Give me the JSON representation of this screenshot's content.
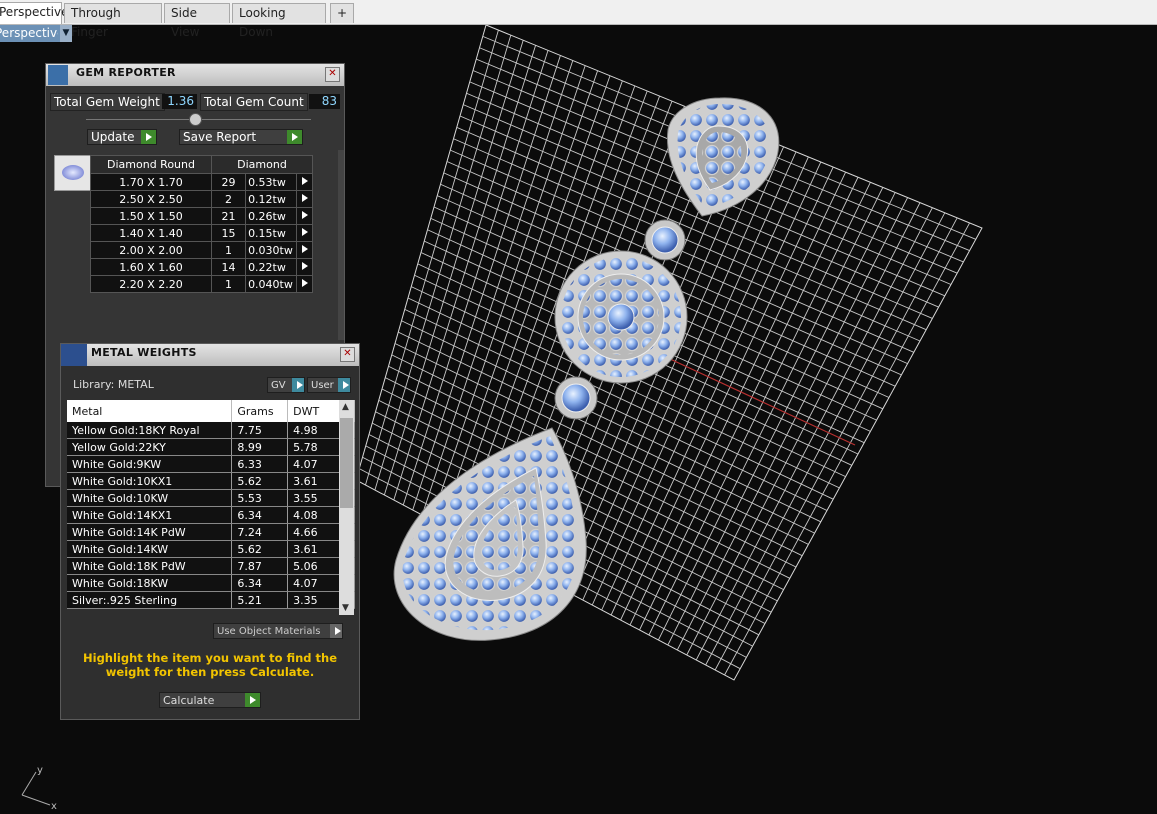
{
  "tabs": [
    "Perspective",
    "Through Finger",
    "Side View",
    "Looking Down"
  ],
  "add_tab": "+",
  "viewport_label": "Perspective",
  "gem_reporter": {
    "title": "GEM REPORTER",
    "total_weight_label": "Total Gem Weight",
    "total_weight": "1.36",
    "total_count_label": "Total Gem Count",
    "total_count": "83",
    "update_label": "Update",
    "save_label": "Save Report",
    "col_shape": "Diamond Round",
    "col_material": "Diamond",
    "rows": [
      {
        "size": "1.70 X 1.70",
        "count": "29",
        "tw": "0.53tw"
      },
      {
        "size": "2.50 X 2.50",
        "count": "2",
        "tw": "0.12tw"
      },
      {
        "size": "1.50 X 1.50",
        "count": "21",
        "tw": "0.26tw"
      },
      {
        "size": "1.40 X 1.40",
        "count": "15",
        "tw": "0.15tw"
      },
      {
        "size": "2.00 X 2.00",
        "count": "1",
        "tw": "0.030tw"
      },
      {
        "size": "1.60 X 1.60",
        "count": "14",
        "tw": "0.22tw"
      },
      {
        "size": "2.20 X 2.20",
        "count": "1",
        "tw": "0.040tw"
      }
    ]
  },
  "metal_weights": {
    "title": "METAL WEIGHTS",
    "library": "Library: METAL",
    "gv": "GV",
    "user": "User",
    "cols": [
      "Metal",
      "Grams",
      "DWT"
    ],
    "rows": [
      {
        "metal": "Yellow Gold:18KY Royal",
        "grams": "7.75",
        "dwt": "4.98"
      },
      {
        "metal": "Yellow Gold:22KY",
        "grams": "8.99",
        "dwt": "5.78"
      },
      {
        "metal": "White Gold:9KW",
        "grams": "6.33",
        "dwt": "4.07"
      },
      {
        "metal": "White Gold:10KX1",
        "grams": "5.62",
        "dwt": "3.61"
      },
      {
        "metal": "White Gold:10KW",
        "grams": "5.53",
        "dwt": "3.55"
      },
      {
        "metal": "White Gold:14KX1",
        "grams": "6.34",
        "dwt": "4.08"
      },
      {
        "metal": "White Gold:14K PdW",
        "grams": "7.24",
        "dwt": "4.66"
      },
      {
        "metal": "White Gold:14KW",
        "grams": "5.62",
        "dwt": "3.61"
      },
      {
        "metal": "White Gold:18K PdW",
        "grams": "7.87",
        "dwt": "5.06"
      },
      {
        "metal": "White Gold:18KW",
        "grams": "6.34",
        "dwt": "4.07"
      },
      {
        "metal": "Silver:.925 Sterling",
        "grams": "5.21",
        "dwt": "3.35"
      }
    ],
    "use_object_materials": "Use Object Materials",
    "hint": "Highlight the item you want to find the weight for then press Calculate.",
    "calculate_label": "Calculate"
  },
  "axis": {
    "x": "x",
    "y": "y"
  }
}
